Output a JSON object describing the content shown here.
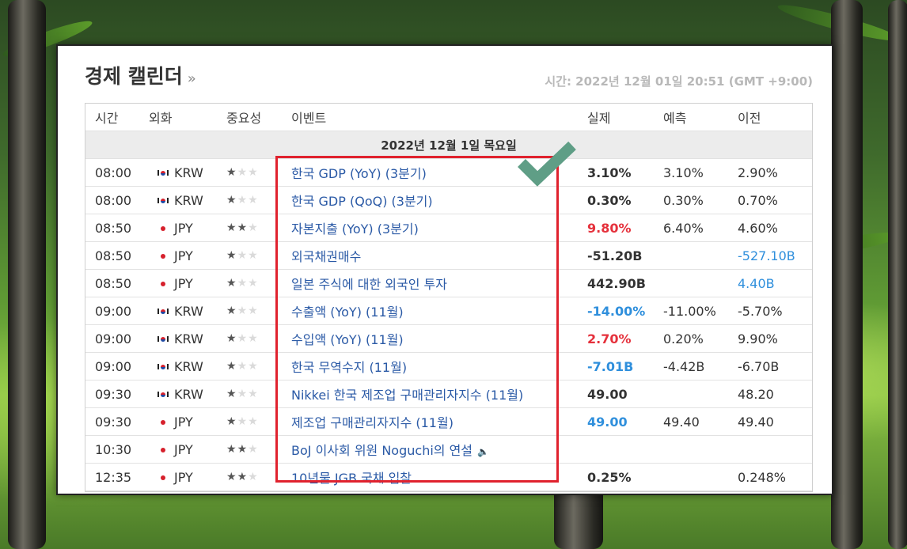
{
  "header": {
    "title": "경제 캘린더",
    "title_arrow": "»",
    "time_text": "시간: 2022년 12월 01일 20:51 (GMT +9:00)"
  },
  "columns": {
    "time": "시간",
    "currency": "외화",
    "importance": "중요성",
    "event": "이벤트",
    "actual": "실제",
    "forecast": "예측",
    "previous": "이전"
  },
  "date_row": "2022년 12월 1일 목요일",
  "rows": [
    {
      "time": "08:00",
      "flag": "kr",
      "currency": "KRW",
      "importance": 1,
      "event": "한국 GDP (YoY) (3분기)",
      "actual": "3.10%",
      "actual_color": "default",
      "forecast": "3.10%",
      "previous": "2.90%",
      "previous_color": "default"
    },
    {
      "time": "08:00",
      "flag": "kr",
      "currency": "KRW",
      "importance": 1,
      "event": "한국 GDP (QoQ) (3분기)",
      "actual": "0.30%",
      "actual_color": "default",
      "forecast": "0.30%",
      "previous": "0.70%",
      "previous_color": "default"
    },
    {
      "time": "08:50",
      "flag": "jp",
      "currency": "JPY",
      "importance": 2,
      "event": "자본지출 (YoY) (3분기)",
      "actual": "9.80%",
      "actual_color": "red",
      "forecast": "6.40%",
      "previous": "4.60%",
      "previous_color": "default"
    },
    {
      "time": "08:50",
      "flag": "jp",
      "currency": "JPY",
      "importance": 1,
      "event": "외국채권매수",
      "actual": "-51.20B",
      "actual_color": "default",
      "forecast": "",
      "previous": "-527.10B",
      "previous_color": "blue"
    },
    {
      "time": "08:50",
      "flag": "jp",
      "currency": "JPY",
      "importance": 1,
      "event": "일본 주식에 대한 외국인 투자",
      "actual": "442.90B",
      "actual_color": "default",
      "forecast": "",
      "previous": "4.40B",
      "previous_color": "blue"
    },
    {
      "time": "09:00",
      "flag": "kr",
      "currency": "KRW",
      "importance": 1,
      "event": "수출액 (YoY) (11월)",
      "actual": "-14.00%",
      "actual_color": "blue",
      "forecast": "-11.00%",
      "previous": "-5.70%",
      "previous_color": "default"
    },
    {
      "time": "09:00",
      "flag": "kr",
      "currency": "KRW",
      "importance": 1,
      "event": "수입액 (YoY) (11월)",
      "actual": "2.70%",
      "actual_color": "red",
      "forecast": "0.20%",
      "previous": "9.90%",
      "previous_color": "default"
    },
    {
      "time": "09:00",
      "flag": "kr",
      "currency": "KRW",
      "importance": 1,
      "event": "한국 무역수지 (11월)",
      "actual": "-7.01B",
      "actual_color": "blue",
      "forecast": "-4.42B",
      "previous": "-6.70B",
      "previous_color": "default"
    },
    {
      "time": "09:30",
      "flag": "kr",
      "currency": "KRW",
      "importance": 1,
      "event": "Nikkei 한국 제조업 구매관리자지수 (11월)",
      "actual": "49.00",
      "actual_color": "default",
      "forecast": "",
      "previous": "48.20",
      "previous_color": "default"
    },
    {
      "time": "09:30",
      "flag": "jp",
      "currency": "JPY",
      "importance": 1,
      "event": "제조업 구매관리자지수 (11월)",
      "actual": "49.00",
      "actual_color": "blue",
      "forecast": "49.40",
      "previous": "49.40",
      "previous_color": "default"
    },
    {
      "time": "10:30",
      "flag": "jp",
      "currency": "JPY",
      "importance": 2,
      "event": "BoJ 이사회 위원 Noguchi의 연설",
      "speaker": true,
      "actual": "",
      "actual_color": "default",
      "forecast": "",
      "previous": "",
      "previous_color": "default"
    },
    {
      "time": "12:35",
      "flag": "jp",
      "currency": "JPY",
      "importance": 2,
      "event": "10년물 JGB 국채 입찰",
      "actual": "0.25%",
      "actual_color": "default",
      "forecast": "",
      "previous": "0.248%",
      "previous_color": "default"
    }
  ],
  "colors": {
    "highlight_box": "#e0222e",
    "checkmark": "#5f9e86",
    "up": "#e5313c",
    "down": "#2f8fdc"
  }
}
